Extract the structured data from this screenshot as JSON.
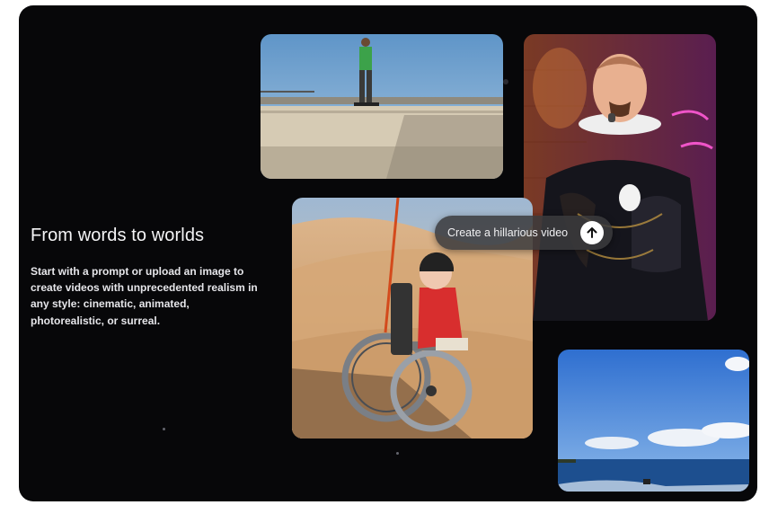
{
  "hero": {
    "title": "From words to worlds",
    "description": "Start with a prompt or upload an image to create videos with unprecedented realism in any style: cinematic, animated, photorealistic, or surreal."
  },
  "prompt_pill": {
    "label": "Create a hillarious video",
    "icon": "arrow-up-icon"
  },
  "gallery": [
    {
      "subject": "skateboarder"
    },
    {
      "subject": "performer-in-costume"
    },
    {
      "subject": "wheelchair-in-desert"
    },
    {
      "subject": "ocean-sky"
    }
  ],
  "colors": {
    "panel_bg": "#070709",
    "text": "#f4f4f6",
    "pill_bg": "#3a3a3c"
  }
}
